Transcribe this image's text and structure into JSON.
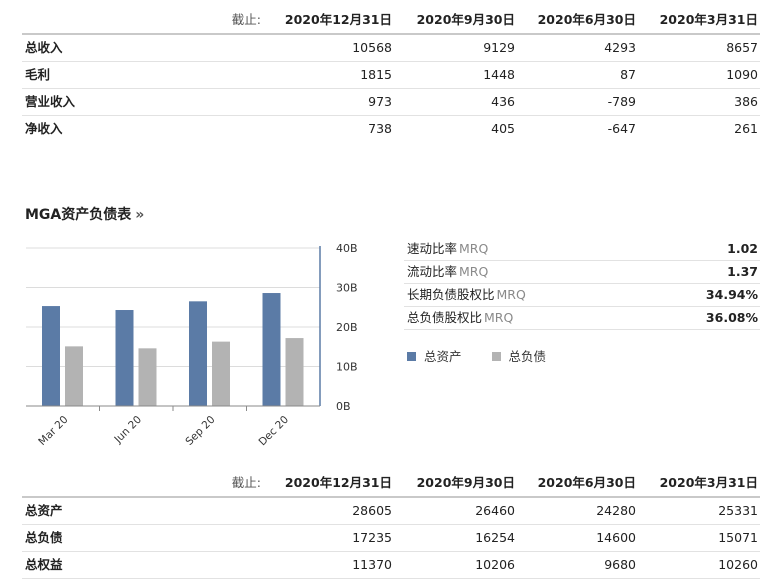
{
  "income_table": {
    "asof_label": "截止:",
    "dates": [
      "2020年12月31日",
      "2020年9月30日",
      "2020年6月30日",
      "2020年3月31日"
    ],
    "rows": [
      {
        "label": "总收入",
        "values": [
          "10568",
          "9129",
          "4293",
          "8657"
        ]
      },
      {
        "label": "毛利",
        "values": [
          "1815",
          "1448",
          "87",
          "1090"
        ]
      },
      {
        "label": "营业收入",
        "values": [
          "973",
          "436",
          "-789",
          "386"
        ]
      },
      {
        "label": "净收入",
        "values": [
          "738",
          "405",
          "-647",
          "261"
        ]
      }
    ]
  },
  "balance_section": {
    "title": "MGA资产负债表",
    "arrow": "»"
  },
  "chart_data": {
    "type": "bar",
    "categories": [
      "Mar 20",
      "Jun 20",
      "Sep 20",
      "Dec 20"
    ],
    "series": [
      {
        "name": "总资产",
        "color": "#5b7ba6",
        "values": [
          25.3,
          24.3,
          26.5,
          28.6
        ]
      },
      {
        "name": "总负债",
        "color": "#b3b3b3",
        "values": [
          15.1,
          14.6,
          16.3,
          17.2
        ]
      }
    ],
    "ylim": [
      0,
      40
    ],
    "yticks": [
      "0B",
      "10B",
      "20B",
      "30B",
      "40B"
    ],
    "y_axis_side": "right",
    "grid": true,
    "legend_position": "bottom-right"
  },
  "ratios": [
    {
      "label": "速动比率",
      "suffix": "MRQ",
      "value": "1.02"
    },
    {
      "label": "流动比率",
      "suffix": "MRQ",
      "value": "1.37"
    },
    {
      "label": "长期负债股权比",
      "suffix": "MRQ",
      "value": "34.94%"
    },
    {
      "label": "总负债股权比",
      "suffix": "MRQ",
      "value": "36.08%"
    }
  ],
  "legend": {
    "assets": "总资产",
    "liabilities": "总负债"
  },
  "balance_table": {
    "asof_label": "截止:",
    "dates": [
      "2020年12月31日",
      "2020年9月30日",
      "2020年6月30日",
      "2020年3月31日"
    ],
    "rows": [
      {
        "label": "总资产",
        "values": [
          "28605",
          "26460",
          "24280",
          "25331"
        ]
      },
      {
        "label": "总负债",
        "values": [
          "17235",
          "16254",
          "14600",
          "15071"
        ]
      },
      {
        "label": "总权益",
        "values": [
          "11370",
          "10206",
          "9680",
          "10260"
        ]
      }
    ]
  }
}
